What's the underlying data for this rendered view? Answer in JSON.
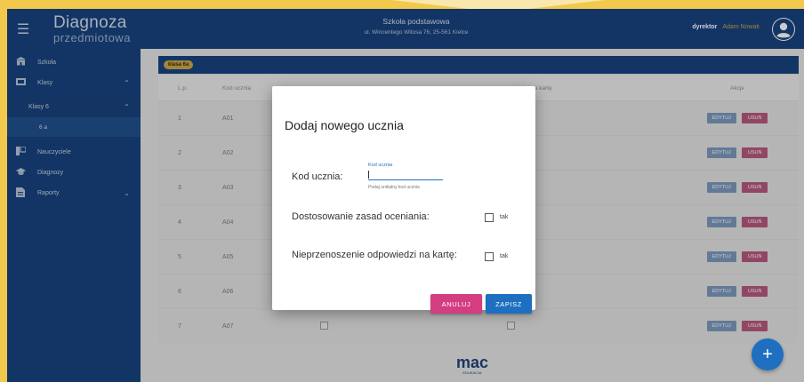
{
  "header": {
    "logo_top": "Diagnoza",
    "logo_bottom": "przedmiotowa",
    "school_name": "Szkoła podstawowa",
    "school_address": "ul. Wincentego Witosa 76, 25-561 Kielce",
    "role": "dyrektor",
    "user_name": "Adam Nowak"
  },
  "sidebar": {
    "items": [
      {
        "label": "Szkoła",
        "icon": "school-icon"
      },
      {
        "label": "Klasy",
        "icon": "classes-icon"
      },
      {
        "label": "Klasy 6",
        "icon": ""
      },
      {
        "label": "6 a",
        "icon": ""
      },
      {
        "label": "Nauczyciele",
        "icon": "teacher-icon"
      },
      {
        "label": "Diagnozy",
        "icon": "graduation-cap-icon"
      },
      {
        "label": "Raporty",
        "icon": "report-icon"
      }
    ]
  },
  "content": {
    "class_chip": "klasa 6a",
    "table": {
      "headers": {
        "lp": "L.p.",
        "kod": "Kod ucznia",
        "niep": "powiedzi na kartę",
        "akcje": "Akcje"
      },
      "edit_label": "EDYTUJ",
      "delete_label": "USUŃ",
      "rows": [
        {
          "lp": "1",
          "kod": "A01"
        },
        {
          "lp": "2",
          "kod": "A02"
        },
        {
          "lp": "3",
          "kod": "A03"
        },
        {
          "lp": "4",
          "kod": "A04"
        },
        {
          "lp": "5",
          "kod": "A05"
        },
        {
          "lp": "6",
          "kod": "A06"
        },
        {
          "lp": "7",
          "kod": "A07"
        }
      ]
    }
  },
  "footer": {
    "brand": "mac",
    "brand_sub": "EDUKACJA"
  },
  "fab": {
    "label": "+"
  },
  "dialog": {
    "title": "Dodaj nowego ucznia",
    "field_kod_label": "Kod ucznia:",
    "input_label": "Kod ucznia",
    "input_value": "",
    "input_help": "Podaj unikalny kod ucznia",
    "field_dost_label": "Dostosowanie zasad oceniania:",
    "field_niep_label": "Nieprzenoszenie odpowiedzi na kartę:",
    "checkbox_text": "tak",
    "cancel_label": "ANULUJ",
    "save_label": "ZAPISZ"
  },
  "colors": {
    "primary": "#123f7e",
    "accent": "#1e6fc0",
    "danger": "#d43d82",
    "gold": "#c9a646"
  }
}
